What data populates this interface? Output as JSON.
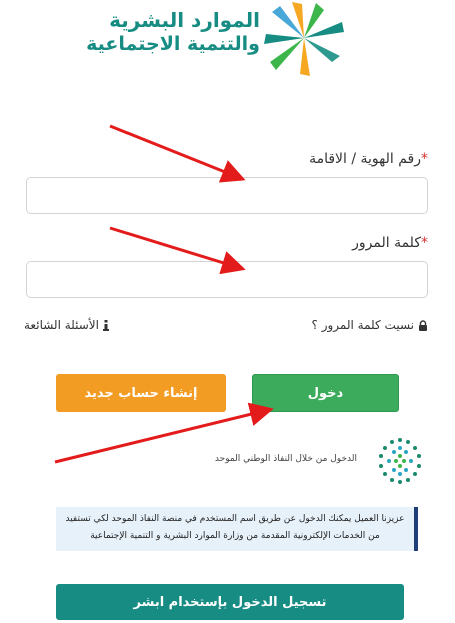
{
  "header": {
    "logo_line1": "الموارد البشرية",
    "logo_line2": "والتنمية الاجتماعية"
  },
  "form": {
    "id_label": "رقم الهوية / الاقامة",
    "password_label": "كلمة المرور",
    "required_mark": "*",
    "id_value": "",
    "password_value": ""
  },
  "links": {
    "forgot_password": "نسيت كلمة المرور ؟",
    "faq": "الأسئلة الشائعة"
  },
  "buttons": {
    "login": "دخول",
    "register": "إنشاء حساب جديد",
    "absher": "تسجيل الدخول بإستخدام ابشر"
  },
  "nafath": {
    "label": "الدخول من خلال النفاذ الوطني الموحد"
  },
  "info": {
    "text": "عزيزنا العميل يمكنك الدخول عن طريق اسم المستخدم في منصة النفاذ الموحد لكي تستفيد من الخدمات الإلكترونية المقدمة من وزارة الموارد البشرية و التنمية الإجتماعية"
  },
  "colors": {
    "brand_teal": "#168c83",
    "login_green": "#3cab5c",
    "register_orange": "#f39c24",
    "arrow_red": "#e41b1b"
  },
  "icons": {
    "lock": "lock-icon",
    "info": "info-icon"
  }
}
